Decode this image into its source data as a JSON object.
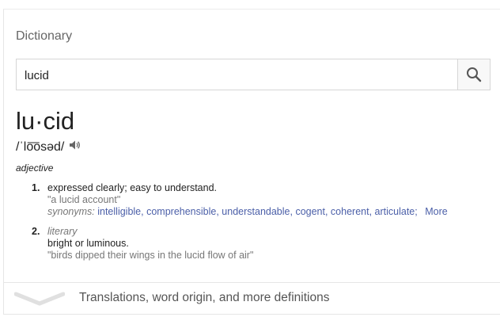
{
  "card": {
    "title": "Dictionary"
  },
  "search": {
    "value": "lucid",
    "button_icon": "search-icon"
  },
  "entry": {
    "headword": "lu·cid",
    "pronunciation": "/ˈlo͞osəd/",
    "audio_icon": "speaker-icon",
    "part_of_speech": "adjective",
    "definitions": [
      {
        "number": "1.",
        "text": "expressed clearly; easy to understand.",
        "example": "\"a lucid account\"",
        "synonyms_label": "synonyms:",
        "synonyms": [
          "intelligible",
          "comprehensible",
          "understandable",
          "cogent",
          "coherent",
          "articulate"
        ],
        "more_label": "More"
      },
      {
        "number": "2.",
        "register": "literary",
        "text": "bright or luminous.",
        "example": "\"birds dipped their wings in the lucid flow of air\""
      }
    ]
  },
  "footer": {
    "label": "Translations, word origin, and more definitions",
    "icon": "chevron-down-icon"
  }
}
